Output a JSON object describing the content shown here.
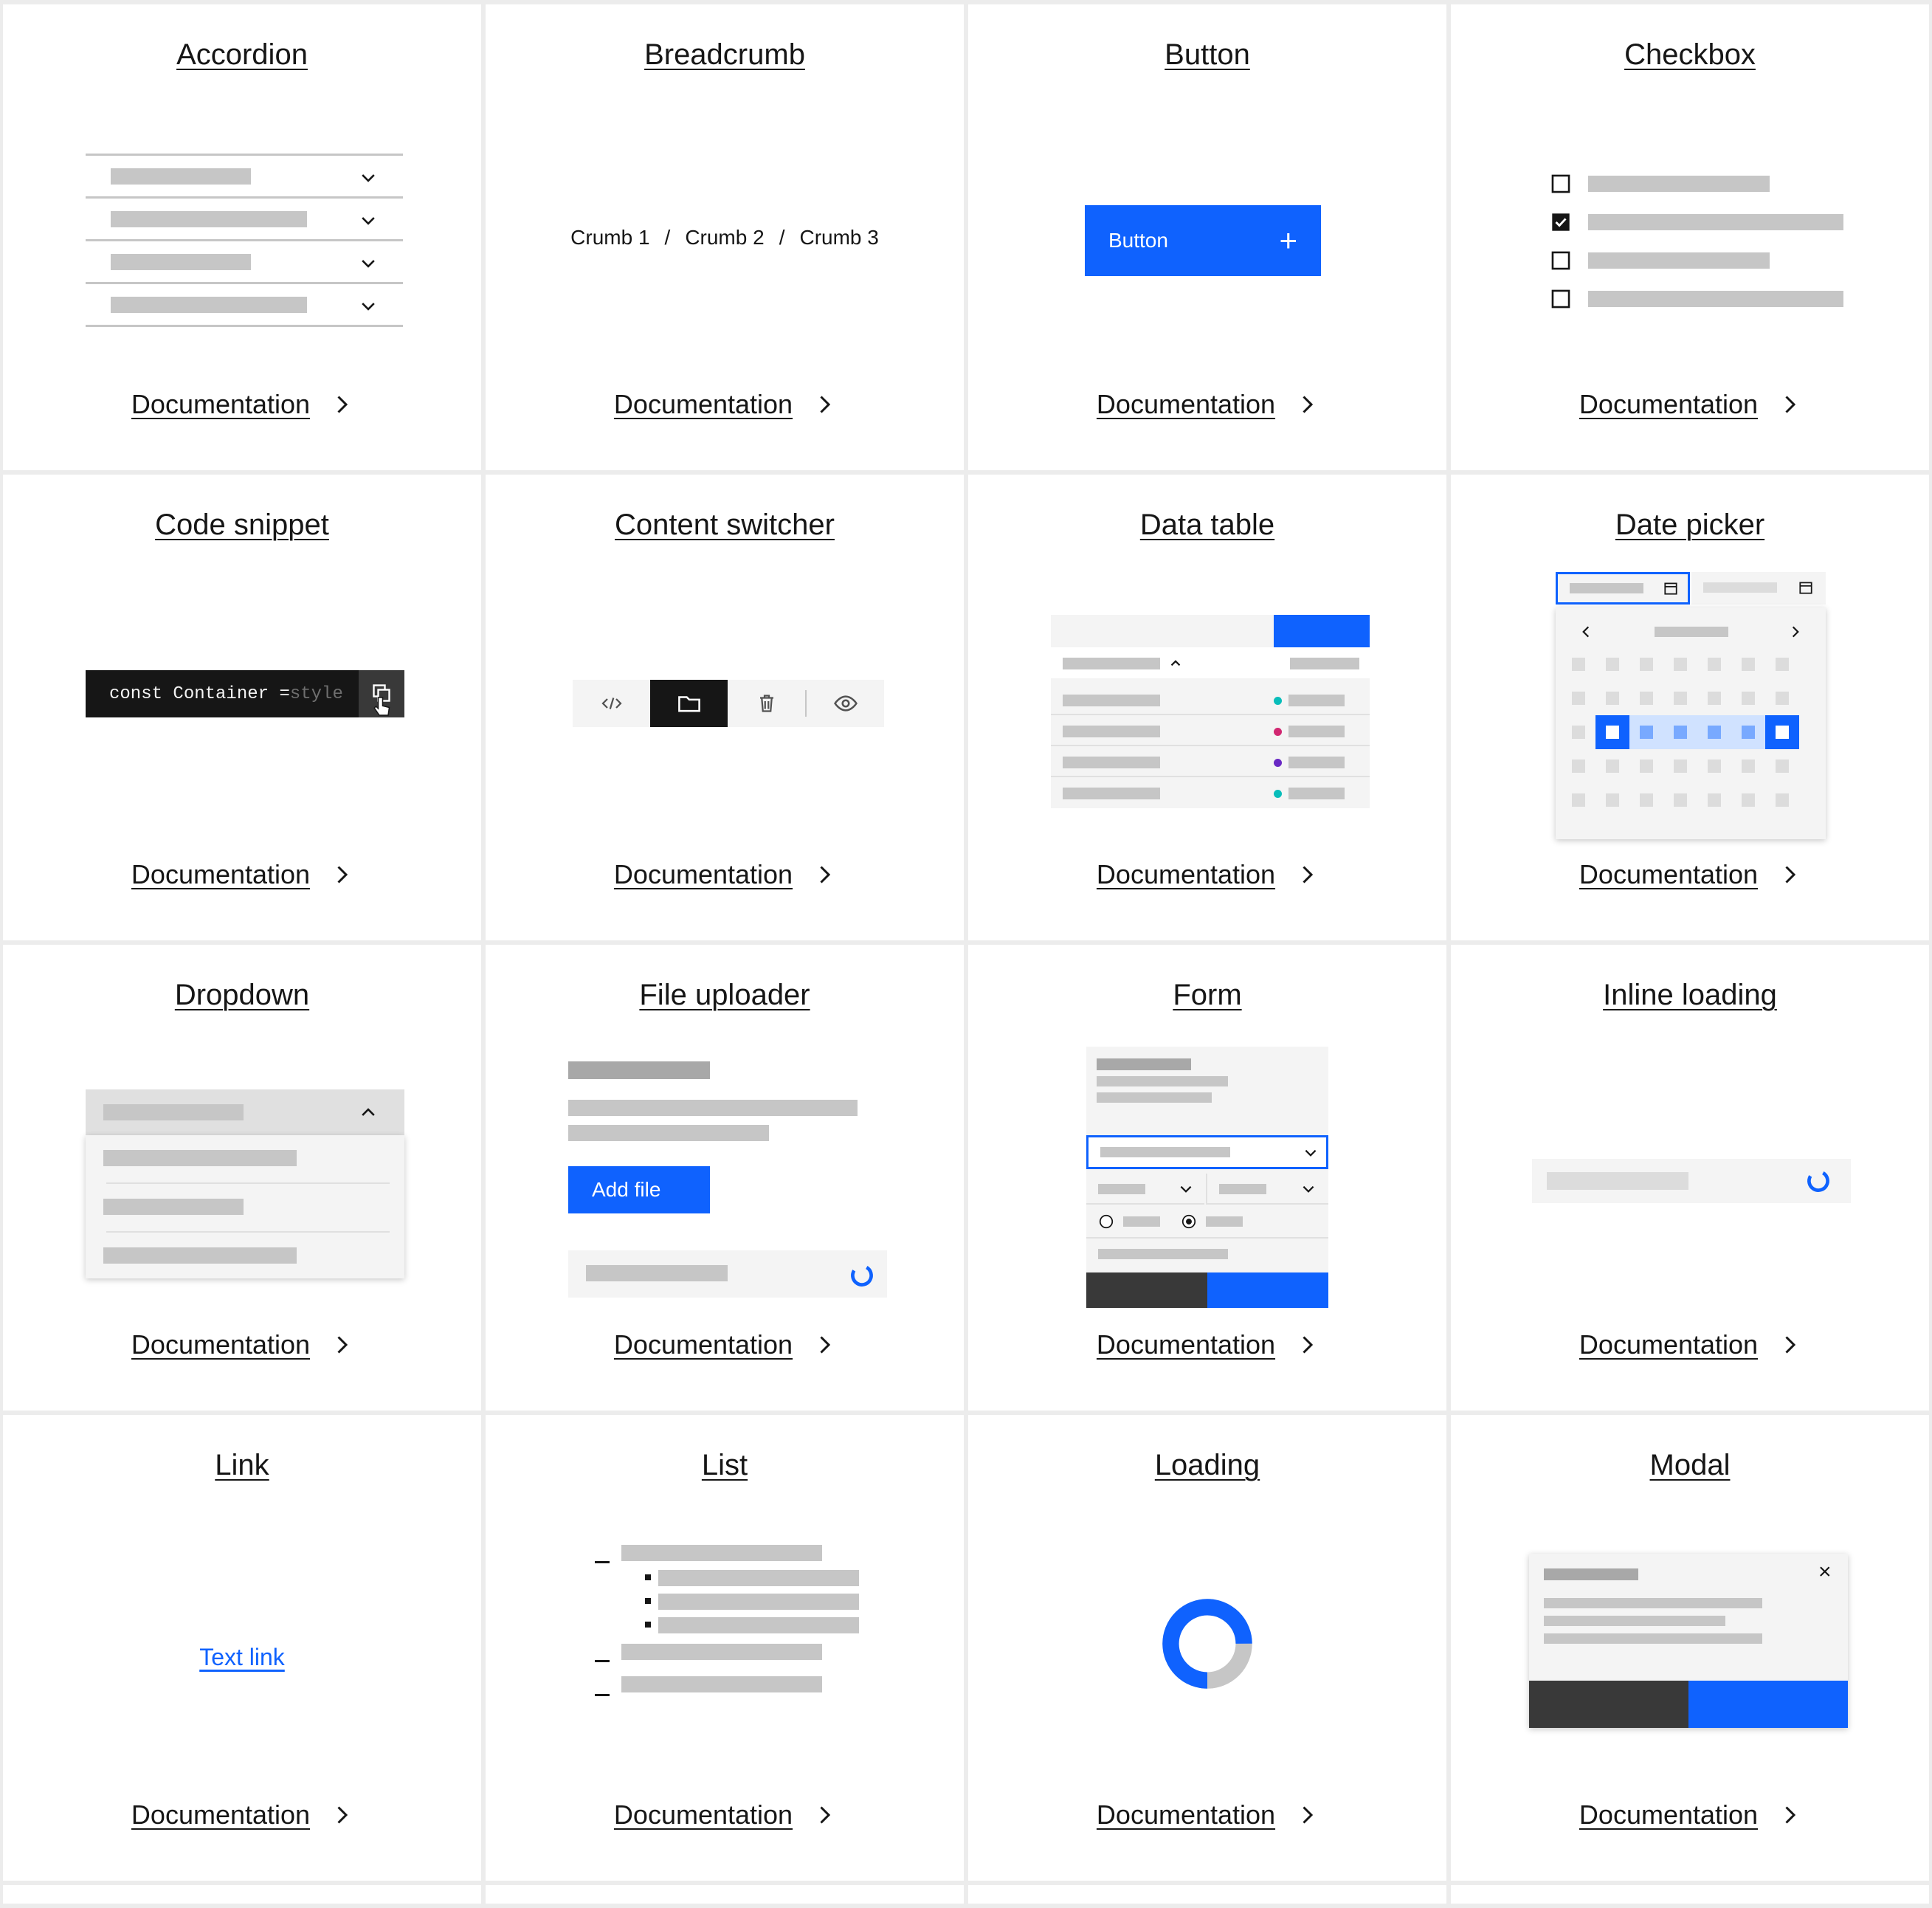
{
  "components": [
    {
      "title": "Accordion"
    },
    {
      "title": "Breadcrumb",
      "crumbs": [
        "Crumb 1",
        "/",
        "Crumb 2",
        "/",
        "Crumb 3"
      ]
    },
    {
      "title": "Button",
      "button_label": "Button",
      "button_icon": "+"
    },
    {
      "title": "Checkbox"
    },
    {
      "title": "Code snippet",
      "code": "const Container = ",
      "code_faded": "style"
    },
    {
      "title": "Content switcher"
    },
    {
      "title": "Data table"
    },
    {
      "title": "Date picker"
    },
    {
      "title": "Dropdown"
    },
    {
      "title": "File uploader",
      "button_label": "Add file"
    },
    {
      "title": "Form"
    },
    {
      "title": "Inline loading"
    },
    {
      "title": "Link",
      "link_label": "Text link"
    },
    {
      "title": "List"
    },
    {
      "title": "Loading"
    },
    {
      "title": "Modal",
      "close": "×"
    }
  ],
  "doc_label": "Documentation",
  "icons": {
    "doc_arrow": "chevron-right-icon"
  },
  "colors": {
    "accent": "#0f62fe",
    "dark": "#161616",
    "placeholder": "#c6c6c6",
    "field": "#f4f4f4",
    "teal": "#08bdba",
    "magenta": "#d12771",
    "purple": "#6929c4"
  }
}
